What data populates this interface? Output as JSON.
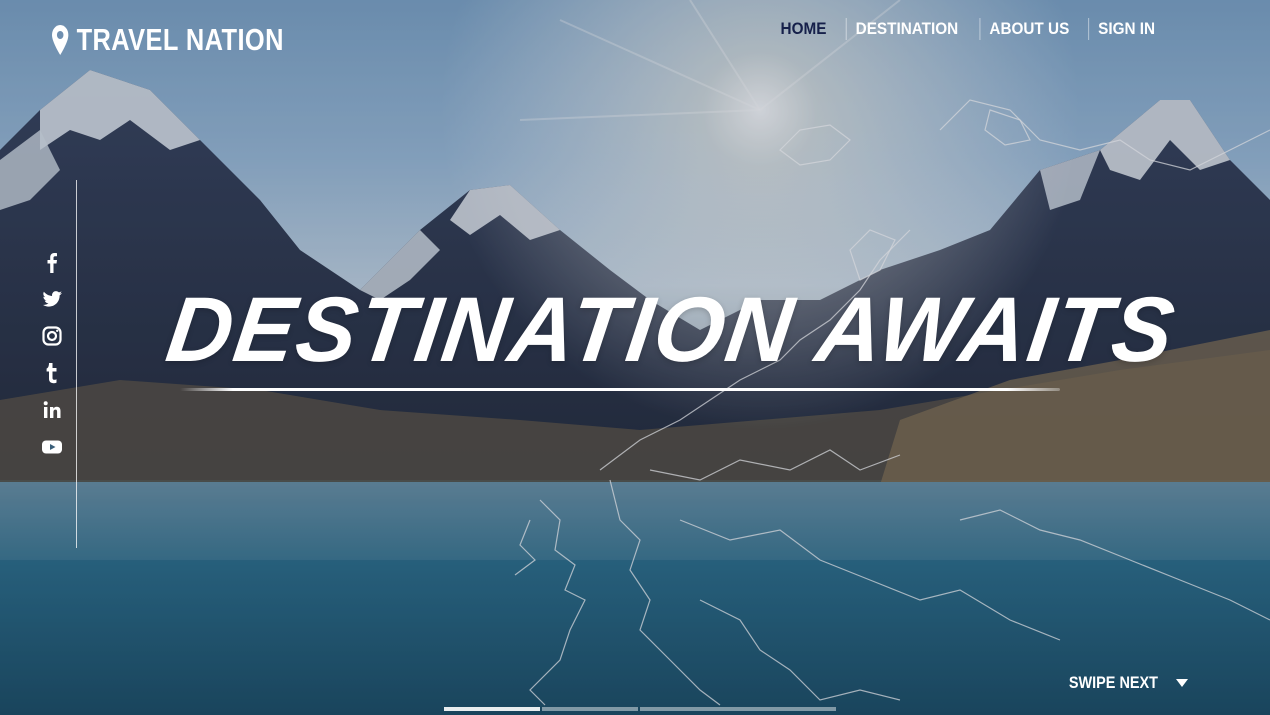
{
  "brand": {
    "name": "TRAVEL NATION"
  },
  "nav": {
    "items": [
      {
        "label": "HOME",
        "active": true
      },
      {
        "label": "DESTINATION",
        "active": false
      },
      {
        "label": "ABOUT US",
        "active": false
      },
      {
        "label": "SIGN IN",
        "active": false
      }
    ]
  },
  "social": [
    "facebook-icon",
    "twitter-icon",
    "instagram-icon",
    "tumblr-icon",
    "linkedin-icon",
    "youtube-icon"
  ],
  "hero": {
    "headline": "DESTINATION AWAITS"
  },
  "swipe": {
    "label": "SWIPE NEXT"
  },
  "slides": {
    "count": 3,
    "active": 1
  },
  "colors": {
    "nav_active": "#16204a",
    "text": "#ffffff"
  }
}
